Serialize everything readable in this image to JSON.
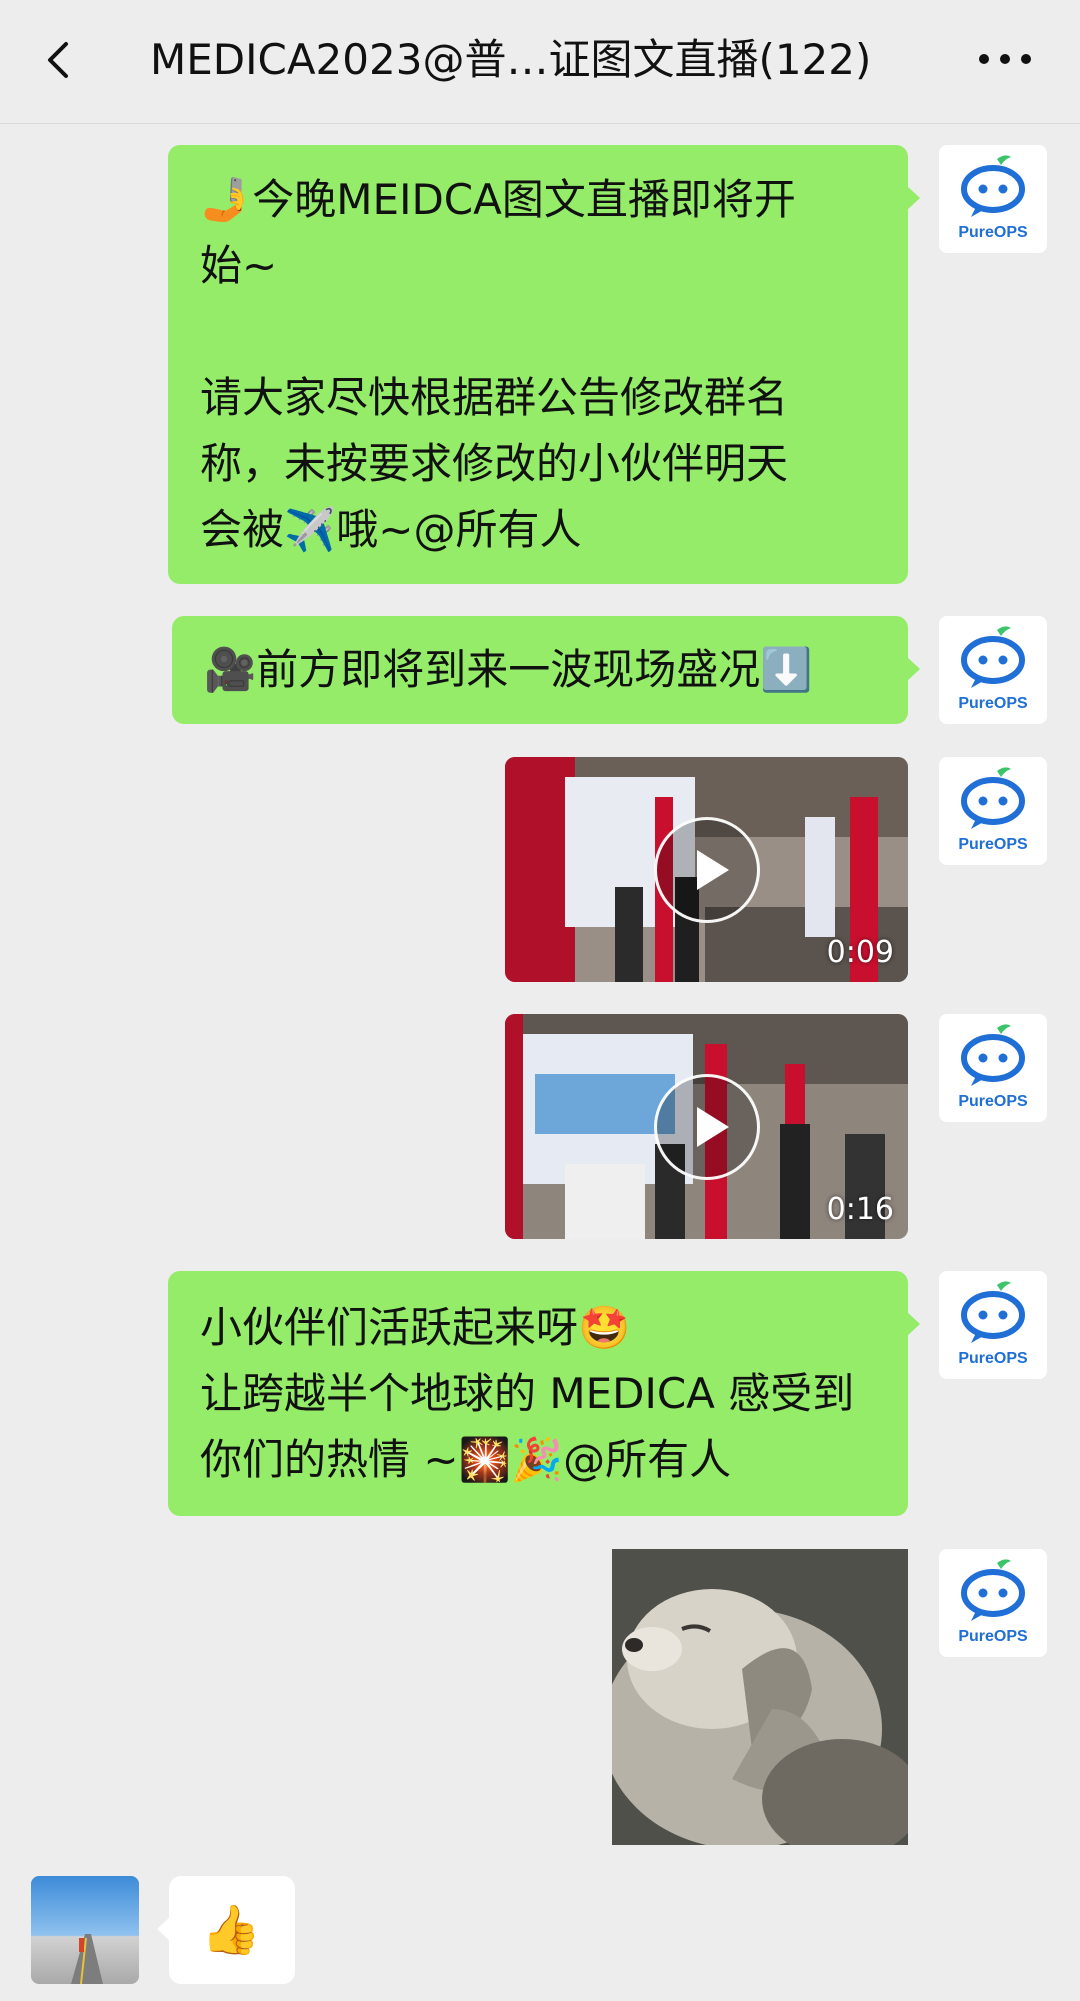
{
  "header": {
    "title": "MEDICA2023@普…证图文直播(122)",
    "back_icon": "chevron-left-icon",
    "more_icon": "more-dots-icon"
  },
  "sender_avatar_label": "PureOPS",
  "messages": [
    {
      "type": "text",
      "lines": [
        "🤳今晚MEIDCA图文直播即将开",
        "始~",
        "",
        "请大家尽快根据群公告修改群名",
        "称，未按要求修改的小伙伴明天",
        "会被✈️哦~@所有人"
      ]
    },
    {
      "type": "text",
      "lines": [
        "🎥前方即将到来一波现场盛况⬇️"
      ]
    },
    {
      "type": "video",
      "duration": "0:09"
    },
    {
      "type": "video",
      "duration": "0:16"
    },
    {
      "type": "text",
      "lines": [
        "小伙伴们活跃起来呀🤩",
        "让跨越半个地球的 MEDICA 感受到",
        "你们的热情 ~🎇🎉@所有人"
      ]
    },
    {
      "type": "sticker",
      "description_icon": "sea-otter-sticker"
    },
    {
      "type": "text_in",
      "lines": [
        "👍"
      ]
    }
  ],
  "colors": {
    "bubble_out": "#95ec69",
    "bubble_in": "#ffffff",
    "background": "#ededed",
    "brand_blue": "#1f6fd6",
    "brand_green": "#3cc46a"
  }
}
